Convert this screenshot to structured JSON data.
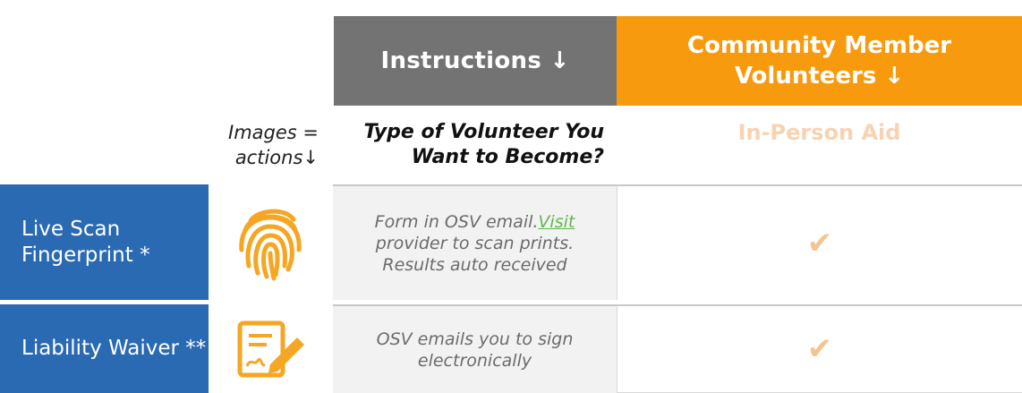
{
  "header": {
    "instructions": "Instructions ↓",
    "community_volunteers": "Community Member Volunteers ↓"
  },
  "subheader": {
    "images_actions": "Images = actions↓",
    "volunteer_type": "Type of Volunteer You Want to Become?",
    "in_person_aid": "In-Person Aid"
  },
  "rows": [
    {
      "label": "Live Scan Fingerprint *",
      "icon": "fingerprint-icon",
      "instruction_before": "Form in OSV email.",
      "instruction_link": "Visit",
      "instruction_after": " provider to scan prints. Results auto received",
      "check": "✔"
    },
    {
      "label": "Liability Waiver **",
      "icon": "sign-document-icon",
      "instruction": "OSV emails you to sign electronically",
      "check": "✔"
    }
  ],
  "colors": {
    "header_gray": "#737373",
    "header_orange": "#f79a0e",
    "row_label_blue": "#2a6ab2",
    "icon_orange": "#f5a623",
    "link_green": "#5fb94e"
  }
}
